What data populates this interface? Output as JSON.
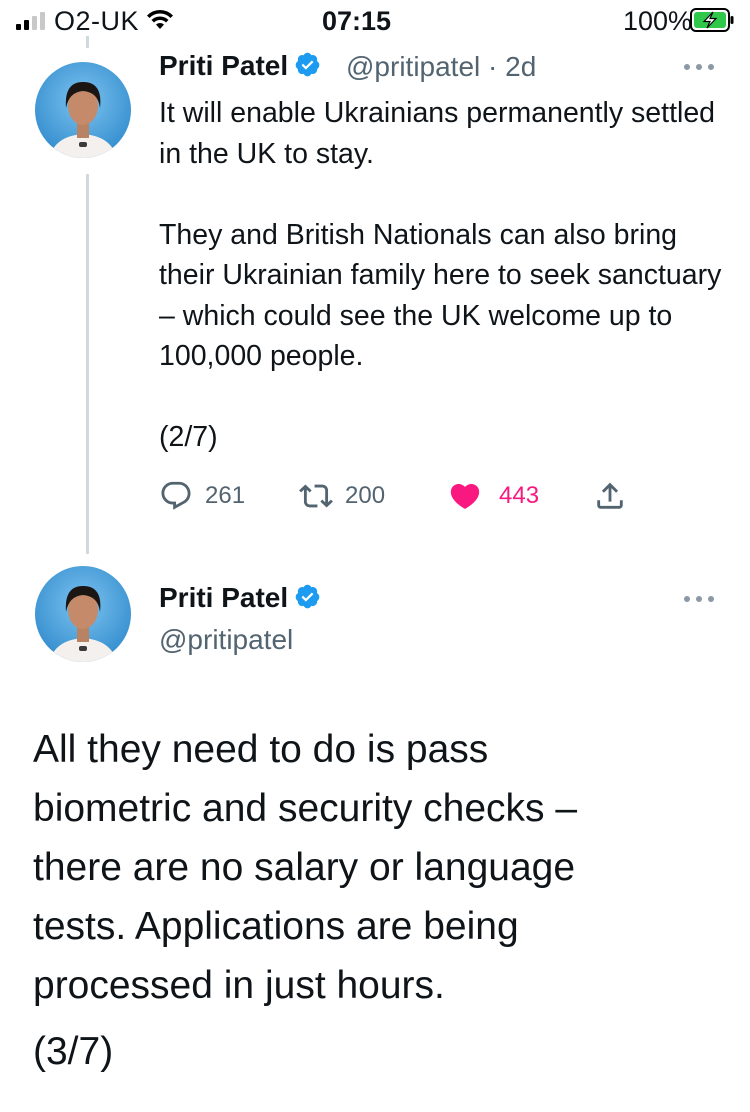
{
  "status_bar": {
    "carrier": "O2-UK",
    "time": "07:15",
    "battery_percent": "100%",
    "icons": [
      "signal-icon",
      "wifi-icon",
      "battery-charging-icon"
    ]
  },
  "tweets": [
    {
      "author_name": "Priti Patel",
      "verified": true,
      "meta": "@pritipatel · 2d",
      "text": "It will enable Ukrainians permanently settled in the UK to stay.\n\nThey and British Nationals can also bring their Ukrainian family here to seek sanctuary – which could see the UK welcome up to 100,000 people.\n\n(2/7)",
      "actions": {
        "replies": "261",
        "retweets": "200",
        "likes": "443",
        "liked": true
      },
      "colors": {
        "like": "#f91880",
        "verified": "#1d9bf0"
      }
    },
    {
      "author_name": "Priti Patel",
      "verified": true,
      "handle": "@pritipatel",
      "text": "All they need to do is pass\nbiometric and security checks –\nthere are no salary or language\ntests. Applications are being\nprocessed in just hours.",
      "thread_count": "(3/7)"
    }
  ]
}
